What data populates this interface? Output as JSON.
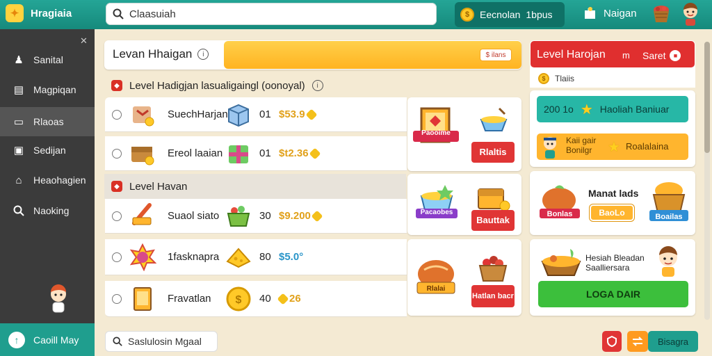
{
  "app": {
    "title": "Hragiaia"
  },
  "search": {
    "value": "Claasuiah"
  },
  "topbar": {
    "currency_label": "Eecnolan",
    "currency_value": "1bpus",
    "nav_label": "Naigan"
  },
  "sidebar": {
    "items": [
      {
        "label": "Sanital",
        "icon": "pawn-icon"
      },
      {
        "label": "Magpiqan",
        "icon": "window-icon"
      },
      {
        "label": "Rlaoas",
        "icon": "card-icon"
      },
      {
        "label": "Sedijan",
        "icon": "bag-icon"
      },
      {
        "label": "Heaohagien",
        "icon": "home-icon"
      },
      {
        "label": "Naoking",
        "icon": "search-icon"
      }
    ],
    "bottom_label": "Caoill May"
  },
  "level_header": {
    "title": "Levan Hhaigan",
    "badge": "$ ilans"
  },
  "sections": [
    {
      "title": "Level Hadigjan lasualigaingl (oonoyal)"
    },
    {
      "title": "Level Havan"
    }
  ],
  "rows": [
    {
      "name": "SuechHarjan",
      "count": "01",
      "price": "$53.9",
      "price_color": "#e1a11b"
    },
    {
      "name": "Ereol laaian",
      "count": "01",
      "price": "$t2.36",
      "price_color": "#e1a11b"
    },
    {
      "name": "Suaol siato",
      "count": "30",
      "price": "$9.200",
      "price_color": "#e1a11b"
    },
    {
      "name": "1fasknapra",
      "count": "80",
      "price": "$5.0°",
      "price_color": "#2a95c9"
    },
    {
      "name": "Fravatlan",
      "count": "40",
      "price": "26",
      "price_color": "#e1a11b"
    }
  ],
  "item_cards": {
    "c1_badge": "Paooime",
    "c1_button": "Rlaltis",
    "c2_badge": "Pacaobes",
    "c2_button": "Bauttak",
    "c3_badge": "Rlalai",
    "c3_button": "Hatlan bacr",
    "c4_badge": "Bo Bunes"
  },
  "right_panel": {
    "title": "Level Harojan",
    "m_label": "m",
    "set_label": "Saret",
    "sub_label": "Tlaiis",
    "teal_value": "200 1o",
    "teal_label": "Haoliah Baniuar",
    "orange_left": "Kaii gair Bonilgr",
    "orange_right": "Roalalaina",
    "card_title": "Manat lads",
    "card_badge": "BaoLo",
    "card_left": "Bonlas",
    "card_right": "Boailas",
    "card2_title": "Hesiah Bleadan Saalliersara",
    "green_button": "LOGA DAIR"
  },
  "bottom": {
    "search_label": "Saslulosin Mgaal",
    "button_label": "Bisagra"
  },
  "colors": {
    "teal": "#1f9e8e",
    "red": "#e02f2f",
    "orange": "#ffb321",
    "green": "#3cbf3c"
  }
}
